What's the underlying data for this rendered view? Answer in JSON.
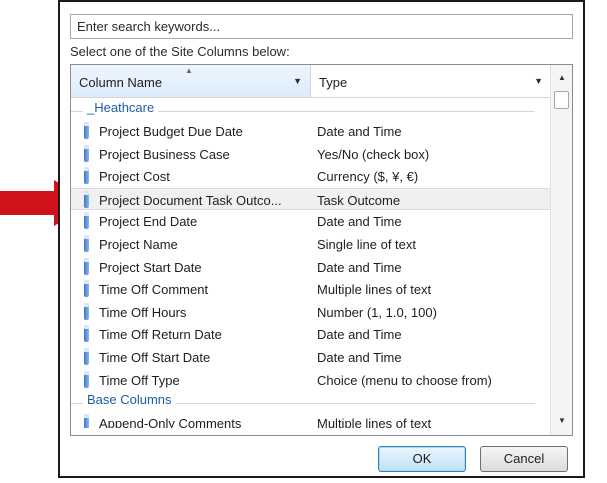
{
  "dialog": {
    "search_placeholder": "Enter search keywords...",
    "instruction": "Select one of the Site Columns below:",
    "columns": {
      "name_header": "Column Name",
      "type_header": "Type"
    },
    "groups": [
      {
        "label": "_Heathcare",
        "rows": [
          {
            "name": "Project Budget Due Date",
            "type": "Date and Time"
          },
          {
            "name": "Project Business Case",
            "type": "Yes/No (check box)"
          },
          {
            "name": "Project Cost",
            "type": "Currency ($, ¥, €)"
          },
          {
            "name": "Project Document Task Outco...",
            "type": "Task Outcome",
            "selected": true
          },
          {
            "name": "Project End Date",
            "type": "Date and Time"
          },
          {
            "name": "Project Name",
            "type": "Single line of text"
          },
          {
            "name": "Project Start Date",
            "type": "Date and Time"
          },
          {
            "name": "Time Off Comment",
            "type": "Multiple lines of text"
          },
          {
            "name": "Time Off Hours",
            "type": "Number (1, 1.0, 100)"
          },
          {
            "name": "Time Off Return Date",
            "type": "Date and Time"
          },
          {
            "name": "Time Off Start Date",
            "type": "Date and Time"
          },
          {
            "name": "Time Off Type",
            "type": "Choice (menu to choose from)"
          }
        ]
      },
      {
        "label": "Base Columns",
        "rows": [
          {
            "name": "Append-Only Comments",
            "type": "Multiple lines of text"
          }
        ]
      }
    ],
    "buttons": {
      "ok": "OK",
      "cancel": "Cancel"
    }
  },
  "colors": {
    "pointer_arrow": "#d0121b",
    "group_label": "#1b5fa6",
    "column_icon": "#3f78c8"
  }
}
